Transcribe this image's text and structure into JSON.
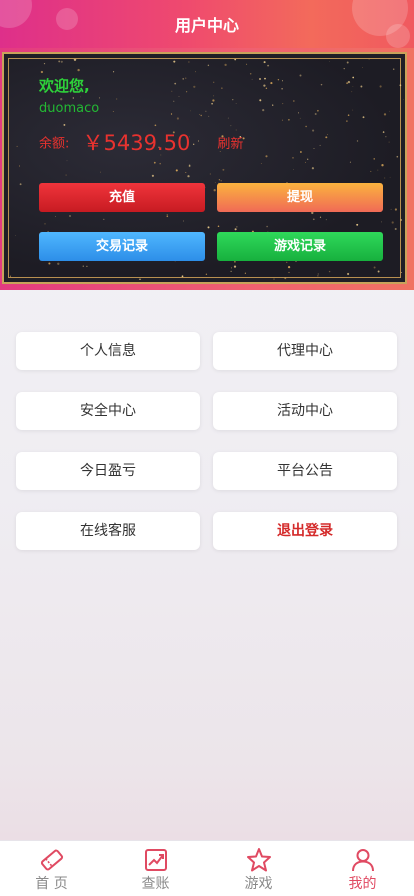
{
  "header": {
    "title": "用户中心"
  },
  "account": {
    "welcome": "欢迎您,",
    "username": "duomaco",
    "balance_label": "余额:",
    "balance_value": "￥5439.50",
    "refresh_label": "刷新"
  },
  "actions": {
    "recharge": "充值",
    "withdraw": "提现",
    "transactions": "交易记录",
    "game_records": "游戏记录"
  },
  "menu": {
    "profile": "个人信息",
    "agent_center": "代理中心",
    "security_center": "安全中心",
    "activity_center": "活动中心",
    "today_pnl": "今日盈亏",
    "platform_notice": "平台公告",
    "online_service": "在线客服",
    "logout": "退出登录"
  },
  "nav": {
    "home": "首 页",
    "account": "查账",
    "games": "游戏",
    "mine": "我的",
    "active": "mine"
  },
  "colors": {
    "accent": "#e04a62",
    "balance": "#e8322f",
    "welcome": "#2ed13a",
    "logout": "#d42a2a"
  }
}
